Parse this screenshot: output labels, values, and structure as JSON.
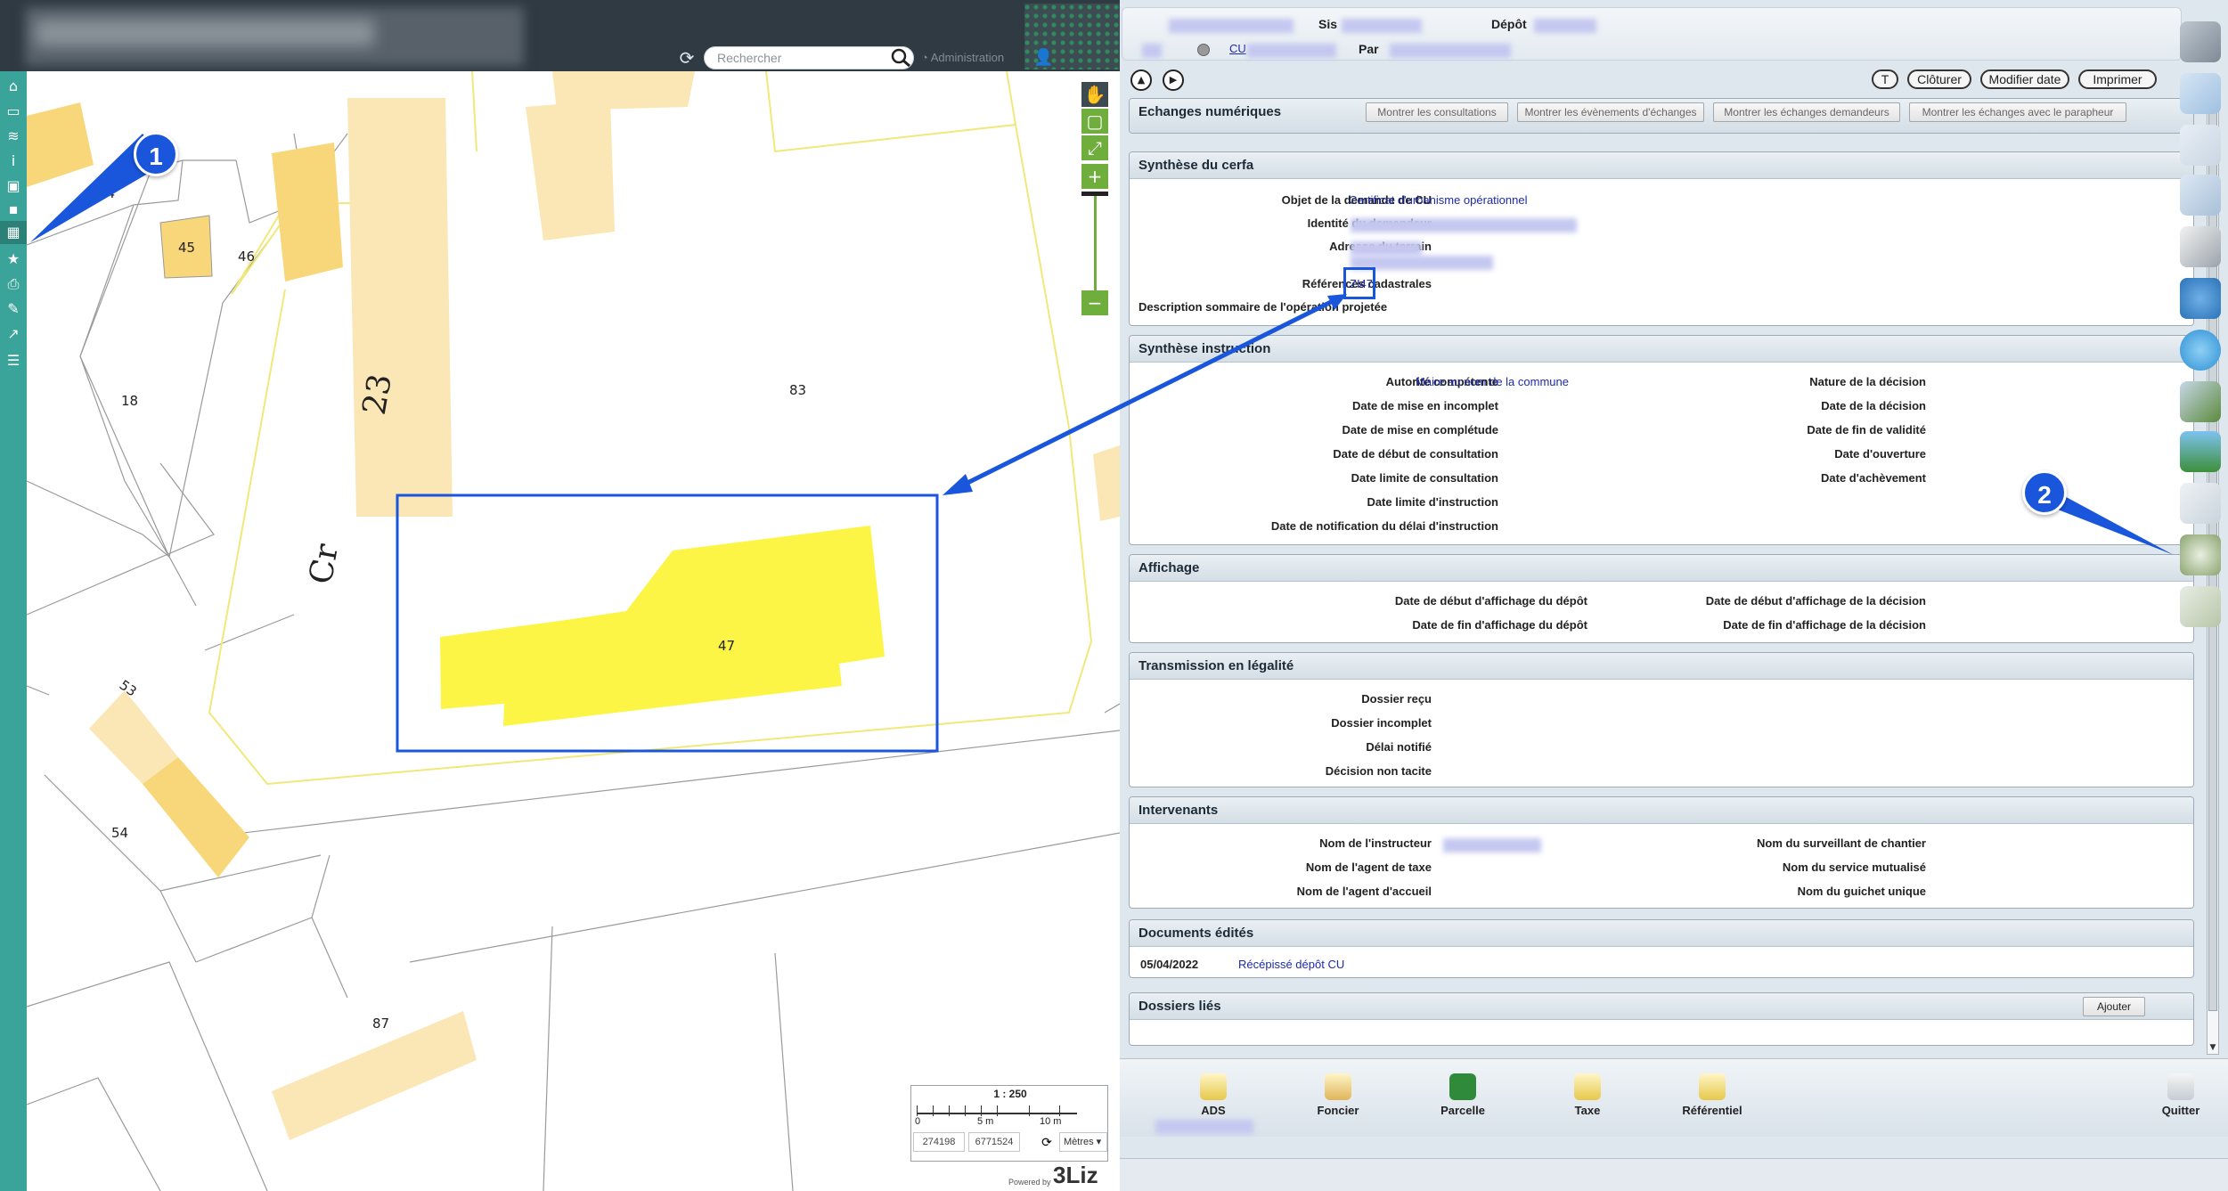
{
  "map": {
    "search_placeholder": "Rechercher",
    "admin_label": "Administration",
    "scale": {
      "ratio": "1 : 250",
      "tick0": "0",
      "tick1": "5 m",
      "tick2": "10 m",
      "x": "274198",
      "y": "6771524",
      "unit": "Mètres"
    },
    "powered_by": "Powered by",
    "logo_text": "3Liz",
    "parcels": [
      "44",
      "45",
      "46",
      "18",
      "83",
      "47",
      "53",
      "54",
      "87"
    ],
    "street_labels": [
      "23",
      "Cr"
    ],
    "colors": {
      "sidebar": "#3aa39a",
      "building_light": "#fbe7b5",
      "building_mid": "#f8d77a",
      "parcel_selected": "#fdf546",
      "highlight": "#1a56db"
    }
  },
  "annotations": {
    "callout1": "1",
    "callout2": "2"
  },
  "ads": {
    "header": {
      "sis_label": "Sis",
      "depot_label": "Dépôt",
      "par_label": "Par",
      "cu_link": "CU"
    },
    "actions": {
      "t": "T",
      "cloturer": "Clôturer",
      "modifier_date": "Modifier date",
      "imprimer": "Imprimer"
    },
    "echanges": {
      "title": "Echanges numériques",
      "buttons": [
        "Montrer les consultations",
        "Montrer les évènements d'échanges",
        "Montrer les échanges demandeurs",
        "Montrer les échanges avec le parapheur"
      ]
    },
    "cerfa": {
      "title": "Synthèse du cerfa",
      "objet_label": "Objet de la demande de CU",
      "objet_value": "Certificat d'urbanisme opérationnel",
      "identite_label": "Identité du demandeur",
      "adresse_label": "Adresse du terrain",
      "references_label": "Références cadastrales",
      "references_value": "ZI47",
      "description_label": "Description sommaire de l'opération projetée"
    },
    "instruction": {
      "title": "Synthèse instruction",
      "autorite_label": "Autorité compétente",
      "autorite_value": "Maire au nom de la commune",
      "left_labels": [
        "Date de mise en incomplet",
        "Date de mise en complétude",
        "Date de début de consultation",
        "Date limite de consultation",
        "Date limite d'instruction",
        "Date de notification du délai d'instruction"
      ],
      "right_labels": [
        "Nature de la décision",
        "Date de la décision",
        "Date de fin de validité",
        "Date d'ouverture",
        "Date d'achèvement"
      ]
    },
    "affichage": {
      "title": "Affichage",
      "left_labels": [
        "Date de début d'affichage du dépôt",
        "Date de fin d'affichage du dépôt"
      ],
      "right_labels": [
        "Date de début d'affichage de la décision",
        "Date de fin d'affichage de la décision"
      ]
    },
    "legalite": {
      "title": "Transmission en légalité",
      "labels": [
        "Dossier reçu",
        "Dossier incomplet",
        "Délai notifié",
        "Décision non tacite"
      ]
    },
    "intervenants": {
      "title": "Intervenants",
      "left_labels": [
        "Nom de l'instructeur",
        "Nom de l'agent de taxe",
        "Nom de l'agent d'accueil"
      ],
      "right_labels": [
        "Nom du surveillant de chantier",
        "Nom du service mutualisé",
        "Nom du guichet unique"
      ]
    },
    "documents": {
      "title": "Documents édités",
      "date": "05/04/2022",
      "doc_link": "Récépissé dépôt CU"
    },
    "lies": {
      "title": "Dossiers liés",
      "ajouter": "Ajouter"
    },
    "bottom": {
      "ads": "ADS",
      "foncier": "Foncier",
      "parcelle": "Parcelle",
      "taxe": "Taxe",
      "referentiel": "Référentiel",
      "quitter": "Quitter"
    },
    "right_icons": [
      "tools-icon",
      "save-icon",
      "folder-icon",
      "documents-icon",
      "printer-icon",
      "users-icon",
      "chat-icon",
      "image-icon",
      "landscape-icon",
      "calculator-icon",
      "magnifier-icon",
      "map-icon"
    ]
  }
}
